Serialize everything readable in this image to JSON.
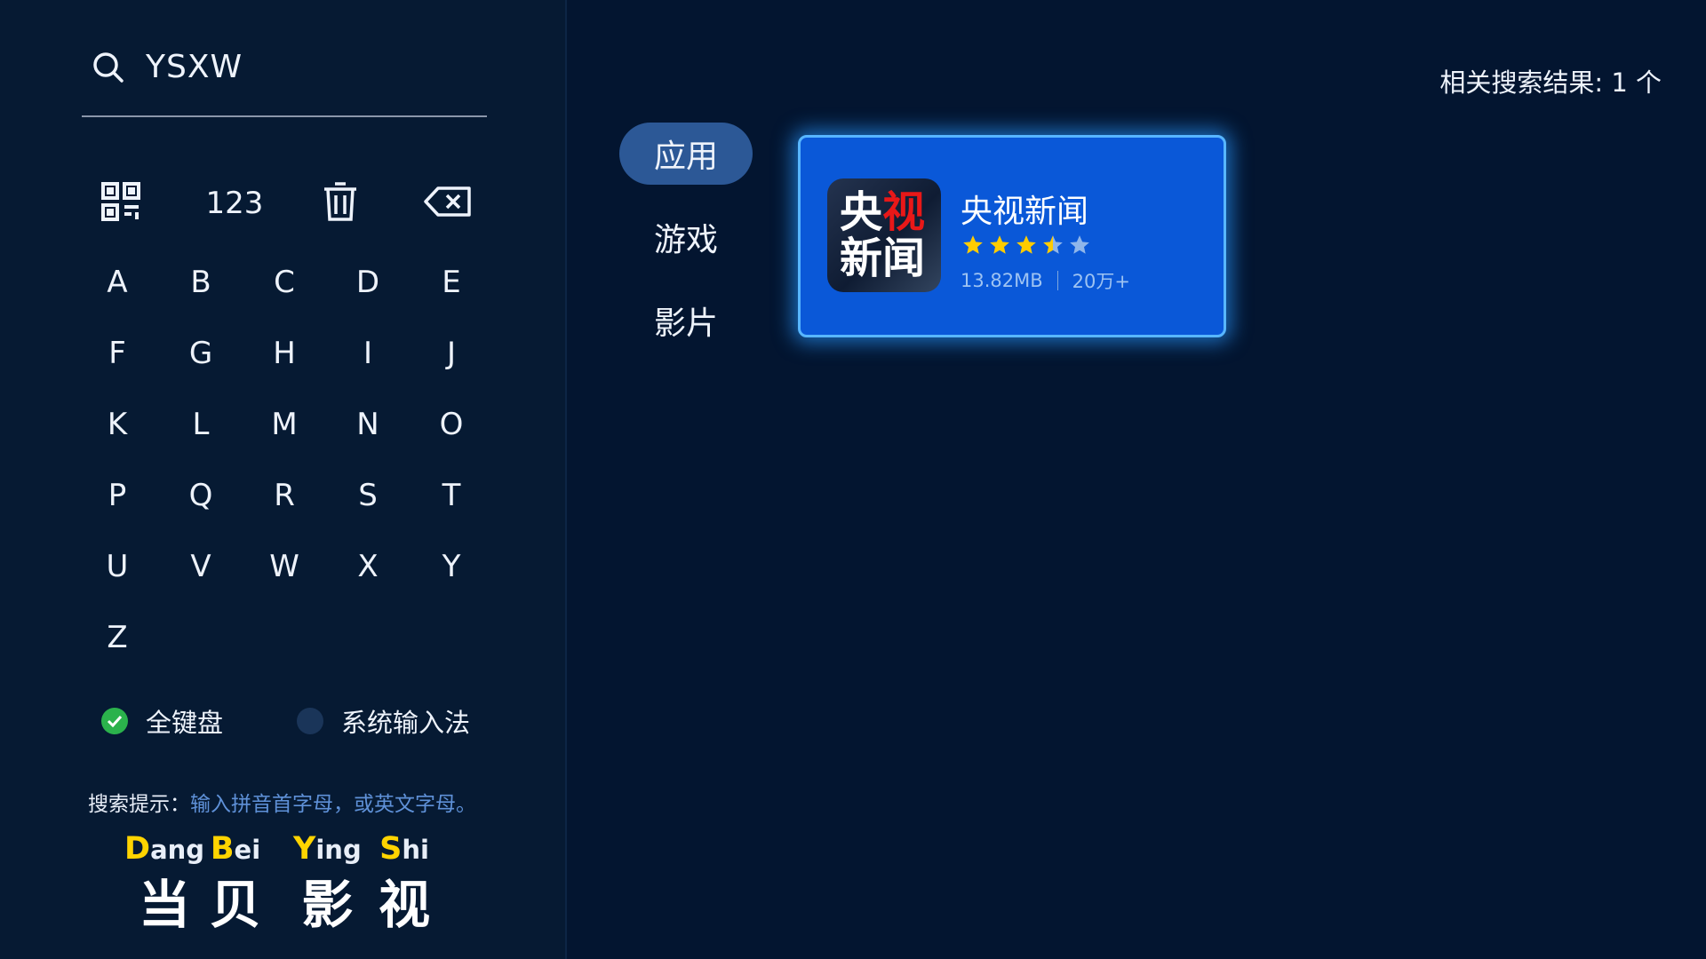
{
  "search": {
    "query": "YSXW"
  },
  "toolbar": {
    "number_label": "123"
  },
  "keyboard": {
    "rows": [
      [
        "A",
        "B",
        "C",
        "D",
        "E"
      ],
      [
        "F",
        "G",
        "H",
        "I",
        "J"
      ],
      [
        "K",
        "L",
        "M",
        "N",
        "O"
      ],
      [
        "P",
        "Q",
        "R",
        "S",
        "T"
      ],
      [
        "U",
        "V",
        "W",
        "X",
        "Y"
      ],
      [
        "Z"
      ]
    ]
  },
  "modes": {
    "full": {
      "label": "全键盘",
      "selected": true
    },
    "system": {
      "label": "系统输入法",
      "selected": false
    }
  },
  "hint": {
    "label": "搜索提示：",
    "text": "输入拼音首字母，或英文字母。"
  },
  "brand": {
    "chars": [
      {
        "cap": "D",
        "rest": "ang",
        "hanzi": "当"
      },
      {
        "cap": "B",
        "rest": "ei",
        "hanzi": "贝"
      },
      {
        "cap": "Y",
        "rest": "ing",
        "hanzi": "影"
      },
      {
        "cap": "S",
        "rest": "hi",
        "hanzi": "视"
      }
    ]
  },
  "tabs": [
    {
      "label": "应用",
      "active": true
    },
    {
      "label": "游戏",
      "active": false
    },
    {
      "label": "影片",
      "active": false
    }
  ],
  "results": {
    "count_text": "相关搜索结果: 1 个"
  },
  "app": {
    "name": "央视新闻",
    "icon_line1": "央",
    "icon_line1_red": "视",
    "icon_line2": "新闻",
    "rating": 3.5,
    "rating_max": 5,
    "size": "13.82MB",
    "downloads": "20万+"
  },
  "colors": {
    "background": "#031530",
    "card": "#0a58d8",
    "active_tab": "#2c5896",
    "pinyin_highlight": "#ffd400",
    "hint_text": "#5f91d8",
    "check_green": "#2bb24c",
    "star_filled": "#ffcc00",
    "star_empty": "#8fb6ea"
  }
}
